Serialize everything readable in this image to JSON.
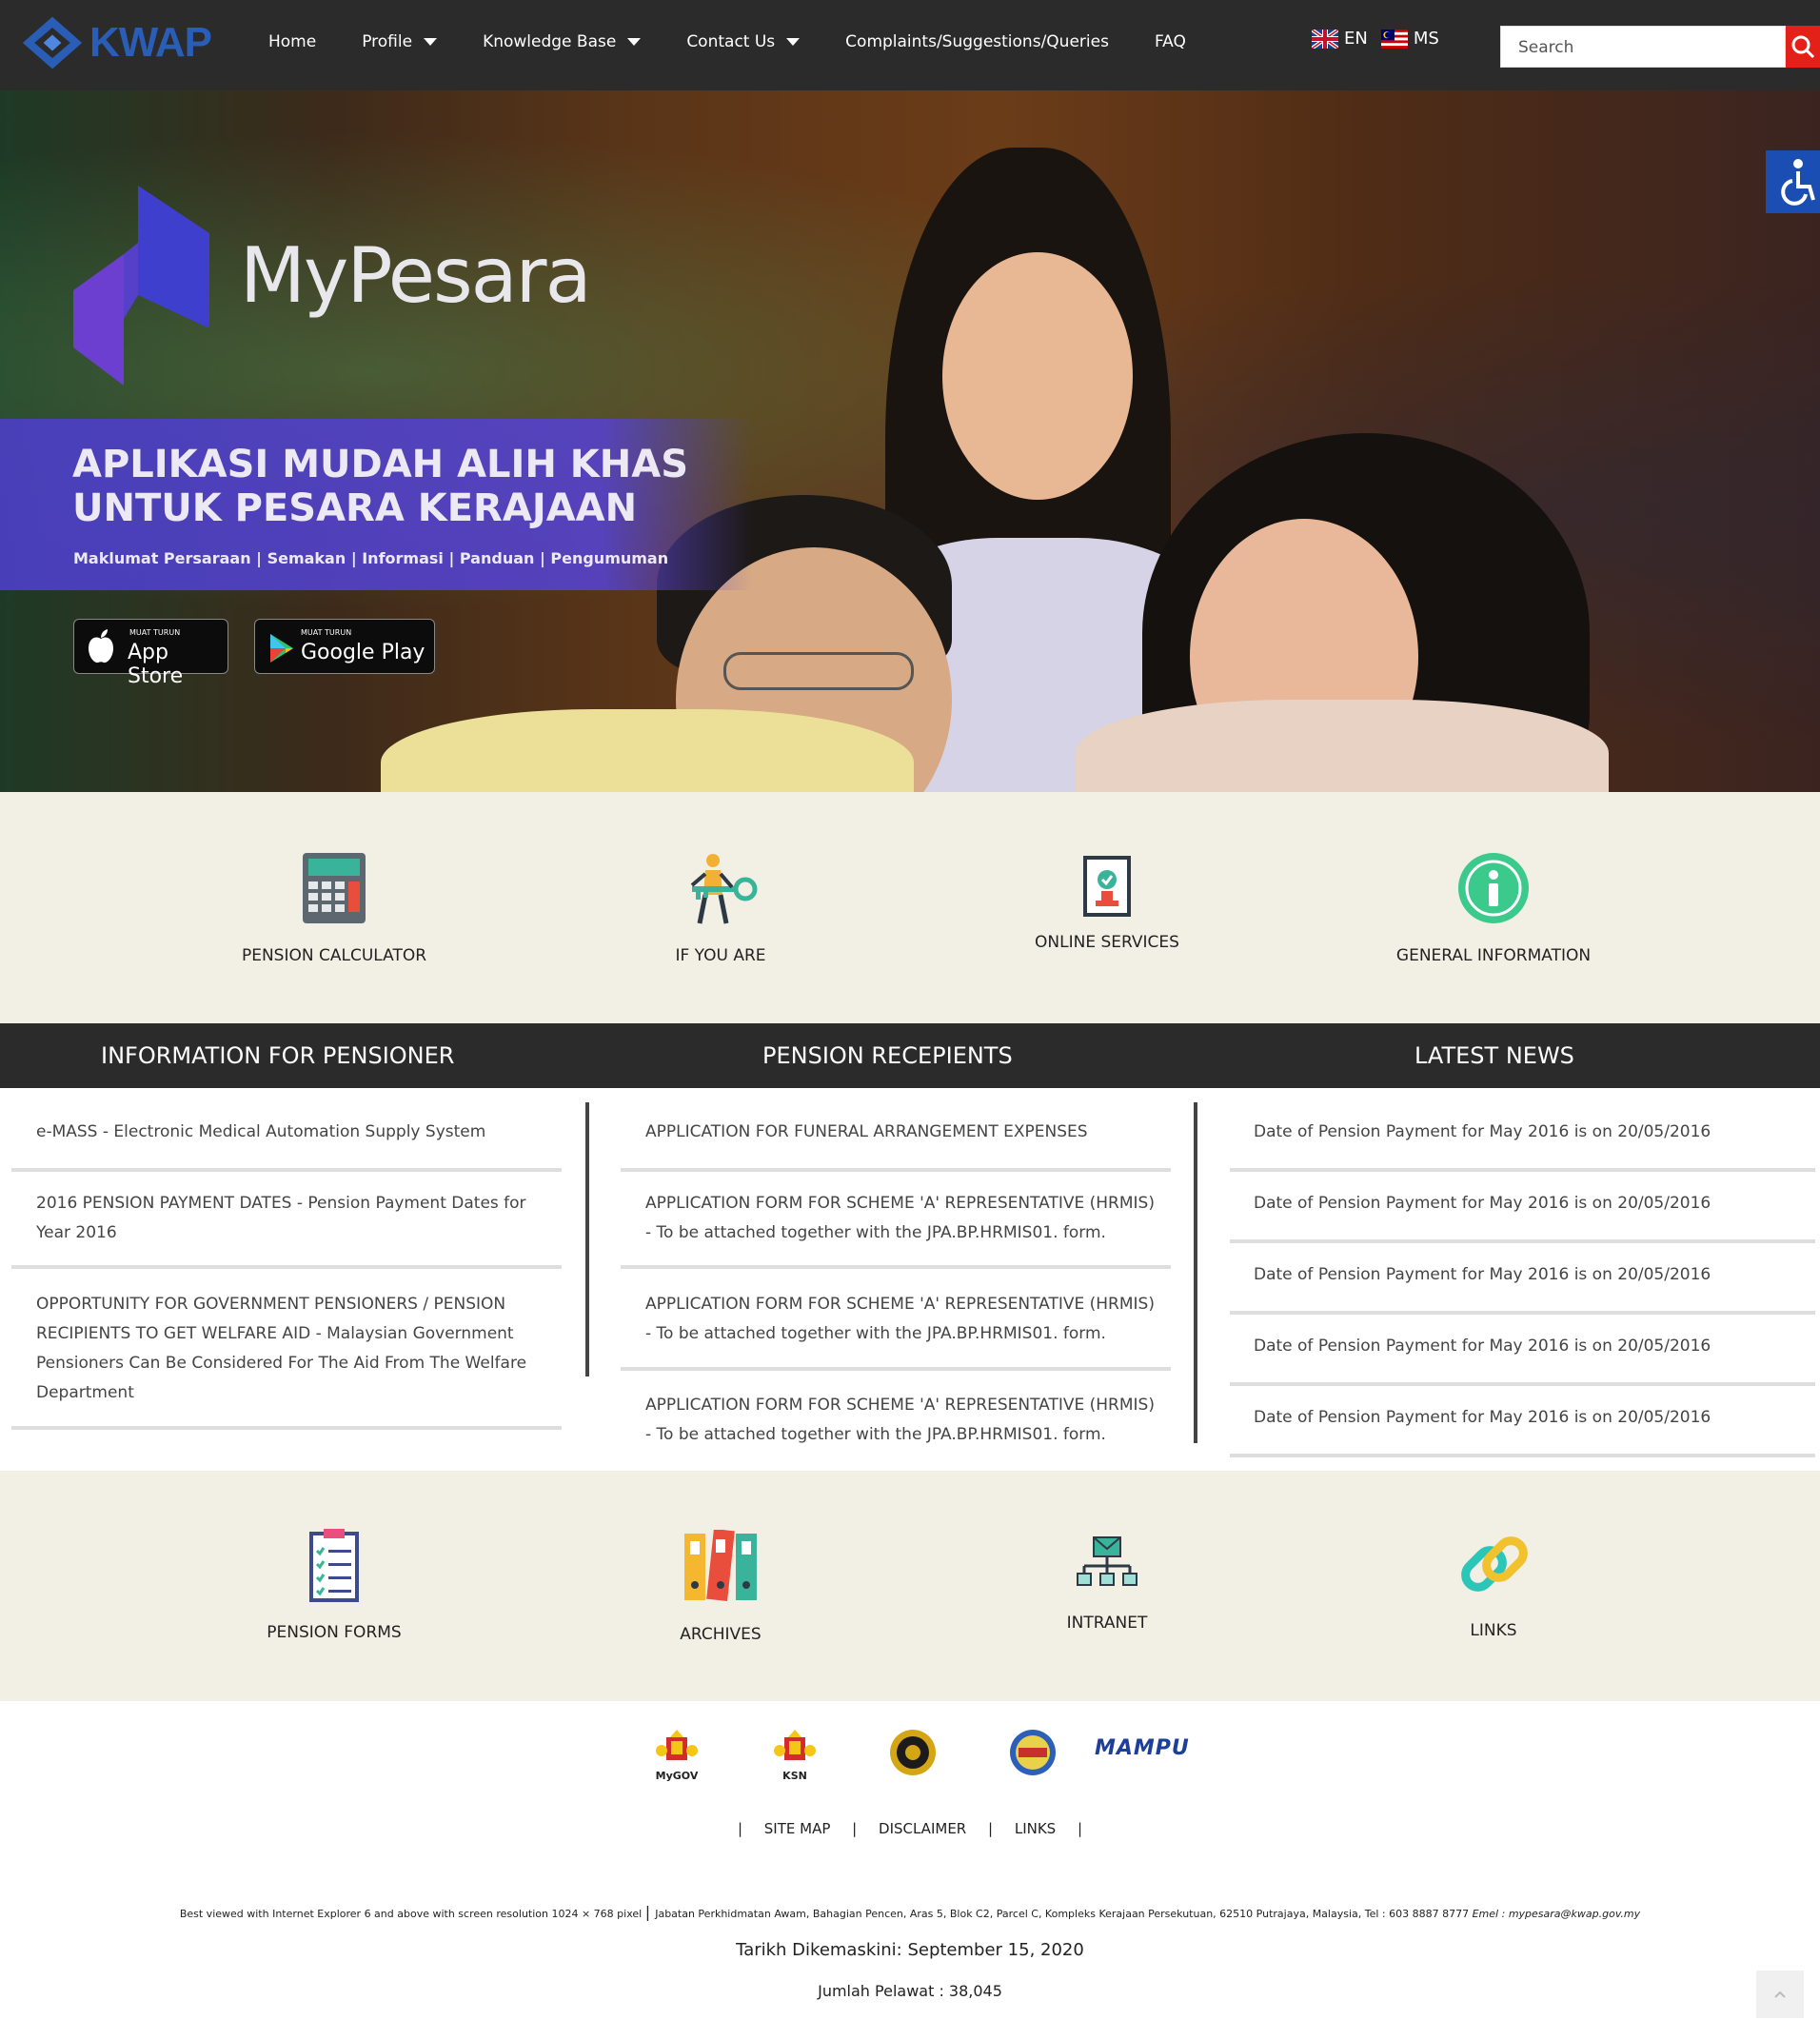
{
  "brand": {
    "logo_text": "KWAP"
  },
  "nav": {
    "items": [
      {
        "label": "Home",
        "dropdown": false
      },
      {
        "label": "Profile",
        "dropdown": true
      },
      {
        "label": "Knowledge Base",
        "dropdown": true
      },
      {
        "label": "Contact Us",
        "dropdown": true
      },
      {
        "label": "Complaints/Suggestions/Queries",
        "dropdown": false
      },
      {
        "label": "FAQ",
        "dropdown": false
      }
    ],
    "lang_en": "EN",
    "lang_ms": "MS",
    "search_placeholder": "Search"
  },
  "hero": {
    "app_name": "MyPesara",
    "headline_1": "APLIKASI MUDAH ALIH KHAS",
    "headline_2": "UNTUK PESARA KERAJAAN",
    "subline": "Maklumat Persaraan | Semakan | Informasi | Panduan | Pengumuman",
    "appstore_small": "MUAT TURUN",
    "appstore_big": "App Store",
    "googleplay_small": "MUAT TURUN",
    "googleplay_big": "Google Play"
  },
  "quick_links_top": [
    {
      "label": "PENSION CALCULATOR",
      "icon": "calculator-icon"
    },
    {
      "label": "IF YOU ARE",
      "icon": "person-key-icon"
    },
    {
      "label": "ONLINE SERVICES",
      "icon": "online-form-icon"
    },
    {
      "label": "GENERAL INFORMATION",
      "icon": "info-icon"
    }
  ],
  "sections": {
    "info_title": "INFORMATION FOR PENSIONER",
    "recipients_title": "PENSION RECEPIENTS",
    "news_title": "LATEST NEWS",
    "info_items": [
      "e-MASS - Electronic Medical Automation Supply System",
      "2016 PENSION PAYMENT DATES - Pension Payment Dates for Year 2016",
      "OPPORTUNITY FOR GOVERNMENT PENSIONERS / PENSION RECIPIENTS TO GET WELFARE AID - Malaysian Government Pensioners Can Be Considered For The Aid From The Welfare Department"
    ],
    "recipient_items": [
      "APPLICATION FOR FUNERAL ARRANGEMENT EXPENSES",
      "APPLICATION FORM FOR SCHEME 'A' REPRESENTATIVE (HRMIS) - To be attached together with the JPA.BP.HRMIS01. form.",
      "APPLICATION FORM FOR SCHEME 'A' REPRESENTATIVE (HRMIS) - To be attached together with the JPA.BP.HRMIS01. form.",
      "APPLICATION FORM FOR SCHEME 'A' REPRESENTATIVE (HRMIS) - To be attached together with the JPA.BP.HRMIS01. form."
    ],
    "news_items": [
      "Date of Pension Payment for May 2016 is on 20/05/2016",
      "Date of Pension Payment for May 2016 is on 20/05/2016",
      "Date of Pension Payment for May 2016 is on 20/05/2016",
      "Date of Pension Payment for May 2016 is on 20/05/2016",
      "Date of Pension Payment for May 2016 is on 20/05/2016"
    ]
  },
  "quick_links_bottom": [
    {
      "label": "PENSION FORMS",
      "icon": "clipboard-icon"
    },
    {
      "label": "ARCHIVES",
      "icon": "binders-icon"
    },
    {
      "label": "INTRANET",
      "icon": "network-icon"
    },
    {
      "label": "LINKS",
      "icon": "chain-link-icon"
    }
  ],
  "partners": {
    "mygov": "MyGOV",
    "ksn": "KSN",
    "mampu": "MAMPU"
  },
  "footer": {
    "sitemap": "SITE MAP",
    "disclaimer": "DISCLAIMER",
    "links": "LINKS",
    "note": "Best viewed with Internet Explorer 6 and above with screen resolution 1024 × 768 pixel",
    "address": "Jabatan Perkhidmatan Awam, Bahagian Pencen, Aras 5, Blok C2, Parcel C, Kompleks Kerajaan Persekutuan, 62510 Putrajaya, Malaysia, Tel : 603 8887 8777",
    "email_label": "Emel :",
    "email": "mypesara@kwap.gov.my",
    "updated": "Tarikh Dikemaskini: September 15, 2020",
    "visitors": "Jumlah Pelawat : 38,045"
  },
  "colors": {
    "accent_blue": "#2a5db5",
    "nav_bg": "#2b2b2b",
    "search_red": "#e32119",
    "beige": "#f2f0e5",
    "hero_purple": "#4a3fbe"
  }
}
